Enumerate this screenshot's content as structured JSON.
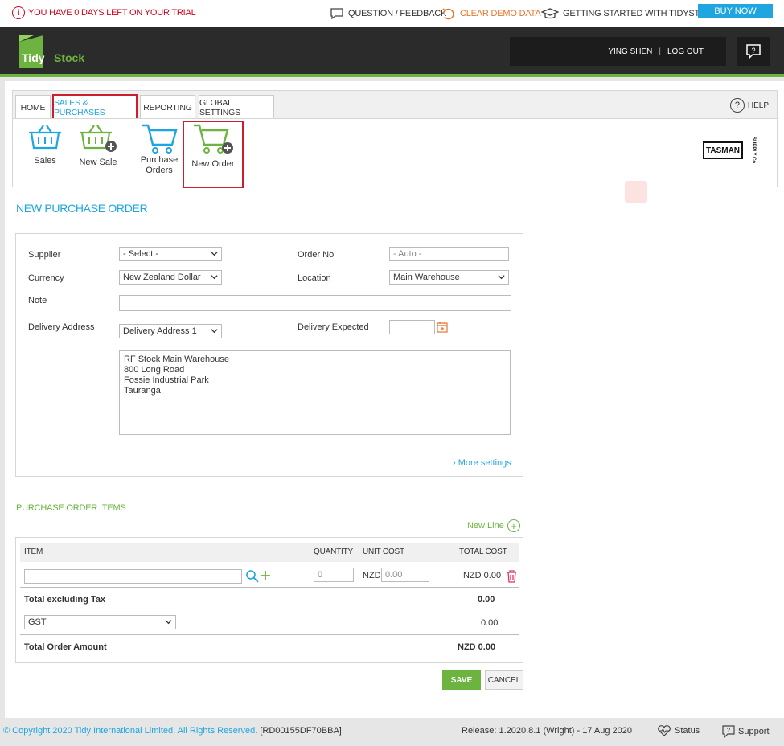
{
  "topbar": {
    "trial_text": "YOU HAVE 0 DAYS LEFT ON YOUR TRIAL",
    "trial_icon": "info-icon",
    "question_feedback": "QUESTION / FEEDBACK",
    "clear_demo": "CLEAR DEMO DATA",
    "getting_started": "GETTING STARTED WITH TIDYSTOCK",
    "buy_now": "BUY NOW"
  },
  "header": {
    "logo_part1": "Tidy",
    "logo_part2": "Stock",
    "user_name": "YING SHEN",
    "separator": "|",
    "logout": "LOG OUT"
  },
  "tabs": [
    {
      "label": "HOME"
    },
    {
      "label": "SALES & PURCHASES"
    },
    {
      "label": "REPORTING"
    },
    {
      "label": "GLOBAL SETTINGS"
    }
  ],
  "help": "HELP",
  "ribbon": {
    "sales": "Sales",
    "new_sale": "New Sale",
    "purchase_orders_1": "Purchase",
    "purchase_orders_2": "Orders",
    "new_order": "New Order",
    "brand": "TASMAN",
    "brand_side": "SUPPLY Co."
  },
  "page_title": "NEW PURCHASE ORDER",
  "form": {
    "supplier_label": "Supplier",
    "supplier_value": "- Select -",
    "order_no_label": "Order No",
    "order_no_placeholder": "- Auto -",
    "currency_label": "Currency",
    "currency_value": "New Zealand Dollar",
    "location_label": "Location",
    "location_value": "Main Warehouse",
    "note_label": "Note",
    "delivery_address_label": "Delivery Address",
    "delivery_address_value": "Delivery Address 1",
    "delivery_expected_label": "Delivery Expected",
    "address_lines": [
      "RF Stock Main Warehouse",
      "800 Long Road",
      "Fossie Industrial Park",
      "Tauranga"
    ],
    "more_settings": "More settings"
  },
  "items": {
    "title": "PURCHASE ORDER ITEMS",
    "new_line": "New Line",
    "col_item": "ITEM",
    "col_quantity": "QUANTITY",
    "col_unit_cost": "UNIT COST",
    "col_total_cost": "TOTAL COST",
    "qty_placeholder": "0",
    "currency_code": "NZD",
    "unit_cost_placeholder": "0.00",
    "row_total": "NZD 0.00",
    "total_ex_tax_label": "Total excluding Tax",
    "total_ex_tax_value": "0.00",
    "tax_value": "GST",
    "tax_amount": "0.00",
    "total_order_label": "Total Order Amount",
    "total_order_value": "NZD 0.00"
  },
  "actions": {
    "save": "SAVE",
    "cancel": "CANCEL"
  },
  "footer": {
    "copyright": "© Copyright 2020 Tidy International Limited. All Rights Reserved.",
    "code": "[RD00155DF70BBA]",
    "release": "Release: 1.2020.8.1 (Wright) - 17 Aug 2020",
    "status": "Status",
    "support": "Support"
  },
  "colors": {
    "accent_blue": "#1fa6e0",
    "accent_green": "#6cb33f",
    "alert_red": "#d0021b",
    "header_dark": "#2b2b2b"
  }
}
